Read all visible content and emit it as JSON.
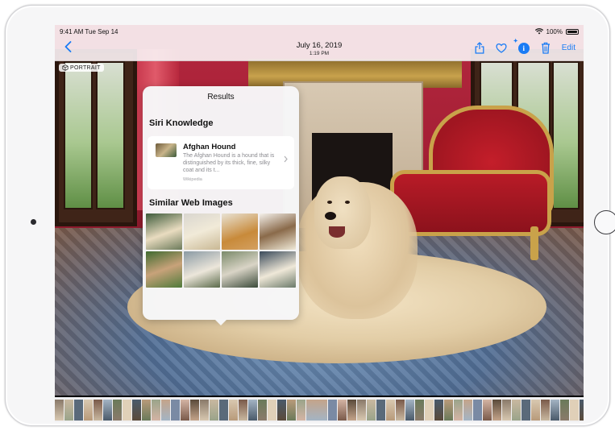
{
  "status": {
    "time_date": "9:41 AM  Tue Sep 14",
    "battery": "100%"
  },
  "nav": {
    "back_icon": "chevron-left-icon",
    "title": "July 16, 2019",
    "subtitle": "1:19 PM",
    "actions": [
      "share-icon",
      "heart-icon",
      "info-icon",
      "trash-icon"
    ],
    "edit_label": "Edit"
  },
  "photo": {
    "badge": "PORTRAIT"
  },
  "popover": {
    "title": "Results",
    "knowledge_heading": "Siri Knowledge",
    "knowledge_card": {
      "name": "Afghan Hound",
      "description": "The Afghan Hound is a hound that is distinguished by its thick, fine, silky coat and its t...",
      "source": "Wikipedia"
    },
    "web_heading": "Similar Web Images"
  },
  "colors": {
    "accent": "#1a7cf5",
    "nav_background": "#f8f0f2"
  }
}
